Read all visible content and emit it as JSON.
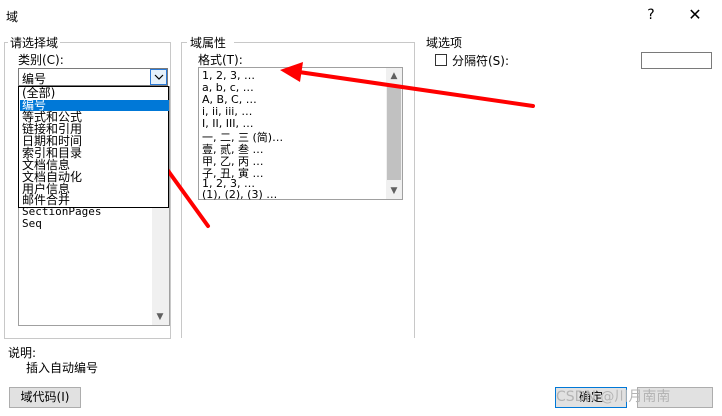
{
  "window": {
    "title": "域",
    "help_label": "?",
    "close_label": "✕"
  },
  "left_group": {
    "title": "请选择域",
    "category_label": "类别(C):",
    "category_value": "编号",
    "category_options": [
      "(全部)",
      "编号",
      "等式和公式",
      "链接和引用",
      "日期和时间",
      "索引和目录",
      "文档信息",
      "文档自动化",
      "用户信息",
      "邮件合并"
    ],
    "selected_index": 1,
    "names_visible": [
      "SectionPages",
      "Seq"
    ]
  },
  "middle_group": {
    "title": "域属性",
    "format_label": "格式(T):",
    "formats": [
      "1, 2, 3, …",
      "a, b, c, …",
      "A, B, C, …",
      "i, ii, iii, …",
      "I, II, III, …",
      "一, 二, 三 (简)…",
      "壹, 贰, 叁 …",
      "甲, 乙, 丙 …",
      "子, 丑, 寅 …",
      "1, 2, 3, …",
      "(1), (2), (3) …"
    ]
  },
  "right_group": {
    "title": "域选项",
    "separator_label": "分隔符(S):",
    "separator_value": ""
  },
  "description": {
    "label": "说明:",
    "text": "插入自动编号"
  },
  "buttons": {
    "field_codes": "域代码(I)",
    "ok": "确定"
  },
  "watermark": "CSDN @川月南南",
  "colors": {
    "selection": "#0078d7",
    "annotation_arrow": "#ff0000"
  }
}
